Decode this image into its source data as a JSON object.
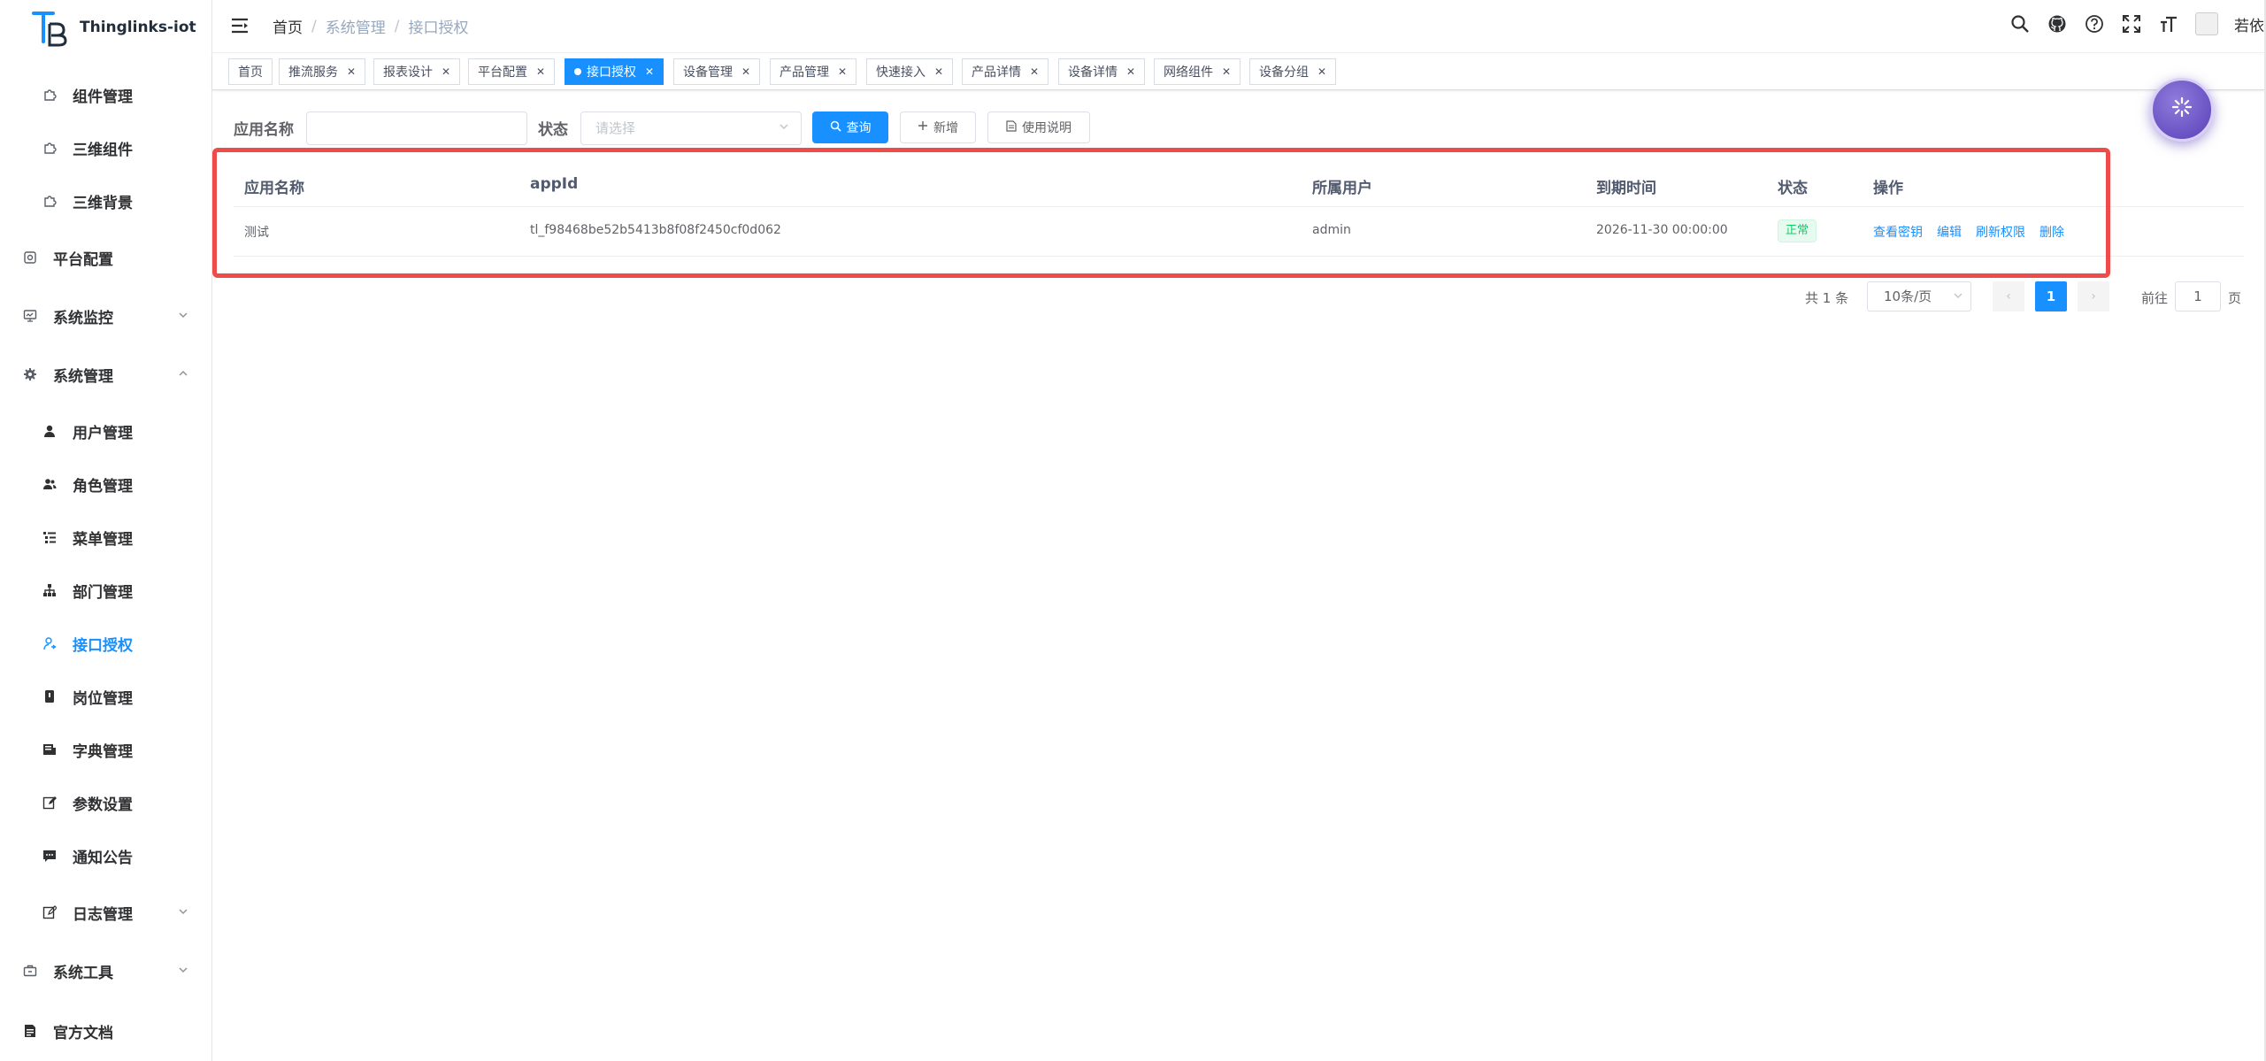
{
  "app": {
    "name": "Thinglinks-iot"
  },
  "sidebar": {
    "items": [
      {
        "label": "组件管理",
        "icon": "puzzle-icon",
        "level": "sub"
      },
      {
        "label": "三维组件",
        "icon": "puzzle-icon",
        "level": "sub"
      },
      {
        "label": "三维背景",
        "icon": "puzzle-icon",
        "level": "sub"
      },
      {
        "label": "平台配置",
        "icon": "config-icon",
        "level": "top"
      },
      {
        "label": "系统监控",
        "icon": "monitor-icon",
        "level": "top",
        "chevron": "down"
      },
      {
        "label": "系统管理",
        "icon": "gear-icon",
        "level": "top",
        "chevron": "up"
      },
      {
        "label": "用户管理",
        "icon": "user-icon",
        "level": "sub"
      },
      {
        "label": "角色管理",
        "icon": "peoples-icon",
        "level": "sub"
      },
      {
        "label": "菜单管理",
        "icon": "tree-table-icon",
        "level": "sub"
      },
      {
        "label": "部门管理",
        "icon": "tree-icon",
        "level": "sub"
      },
      {
        "label": "接口授权",
        "icon": "api-key-icon",
        "level": "sub",
        "active": true
      },
      {
        "label": "岗位管理",
        "icon": "post-icon",
        "level": "sub"
      },
      {
        "label": "字典管理",
        "icon": "dict-icon",
        "level": "sub"
      },
      {
        "label": "参数设置",
        "icon": "edit-icon",
        "level": "sub"
      },
      {
        "label": "通知公告",
        "icon": "message-icon",
        "level": "sub"
      },
      {
        "label": "日志管理",
        "icon": "log-icon",
        "level": "sub",
        "chevron": "down"
      },
      {
        "label": "系统工具",
        "icon": "tool-icon",
        "level": "top",
        "chevron": "down"
      },
      {
        "label": "官方文档",
        "icon": "document-icon",
        "level": "top"
      }
    ]
  },
  "header": {
    "breadcrumb": [
      "首页",
      "系统管理",
      "接口授权"
    ],
    "username": "若依",
    "icons": [
      "search-icon",
      "github-icon",
      "question-icon",
      "fullscreen-icon",
      "font-size-icon"
    ]
  },
  "tags": [
    {
      "label": "首页",
      "closable": false
    },
    {
      "label": "推流服务",
      "closable": true
    },
    {
      "label": "报表设计",
      "closable": true
    },
    {
      "label": "平台配置",
      "closable": true
    },
    {
      "label": "接口授权",
      "closable": true,
      "active": true
    },
    {
      "label": "设备管理",
      "closable": true
    },
    {
      "label": "产品管理",
      "closable": true
    },
    {
      "label": "快速接入",
      "closable": true
    },
    {
      "label": "产品详情",
      "closable": true
    },
    {
      "label": "设备详情",
      "closable": true
    },
    {
      "label": "网络组件",
      "closable": true
    },
    {
      "label": "设备分组",
      "closable": true
    }
  ],
  "search": {
    "app_name_label": "应用名称",
    "app_name_value": "",
    "status_label": "状态",
    "status_placeholder": "请选择",
    "query_label": "查询",
    "add_label": "新增",
    "usage_label": "使用说明"
  },
  "table": {
    "columns": [
      "应用名称",
      "appId",
      "所属用户",
      "到期时间",
      "状态",
      "操作"
    ],
    "rows": [
      {
        "app_name": "测试",
        "app_id": "tl_f98468be52b5413b8f08f2450cf0d062",
        "owner": "admin",
        "expire_time": "2026-11-30 00:00:00",
        "status": "正常",
        "actions": [
          "查看密钥",
          "编辑",
          "刷新权限",
          "删除"
        ]
      }
    ]
  },
  "pagination": {
    "total_text": "共 1 条",
    "page_size": "10条/页",
    "current_page": "1",
    "goto_prefix": "前往",
    "goto_value": "1",
    "goto_suffix": "页"
  },
  "colors": {
    "primary": "#1890ff",
    "highlight_border": "#ee4b4b",
    "status_success": "#13ce66",
    "fab": "#6a4fc8"
  }
}
